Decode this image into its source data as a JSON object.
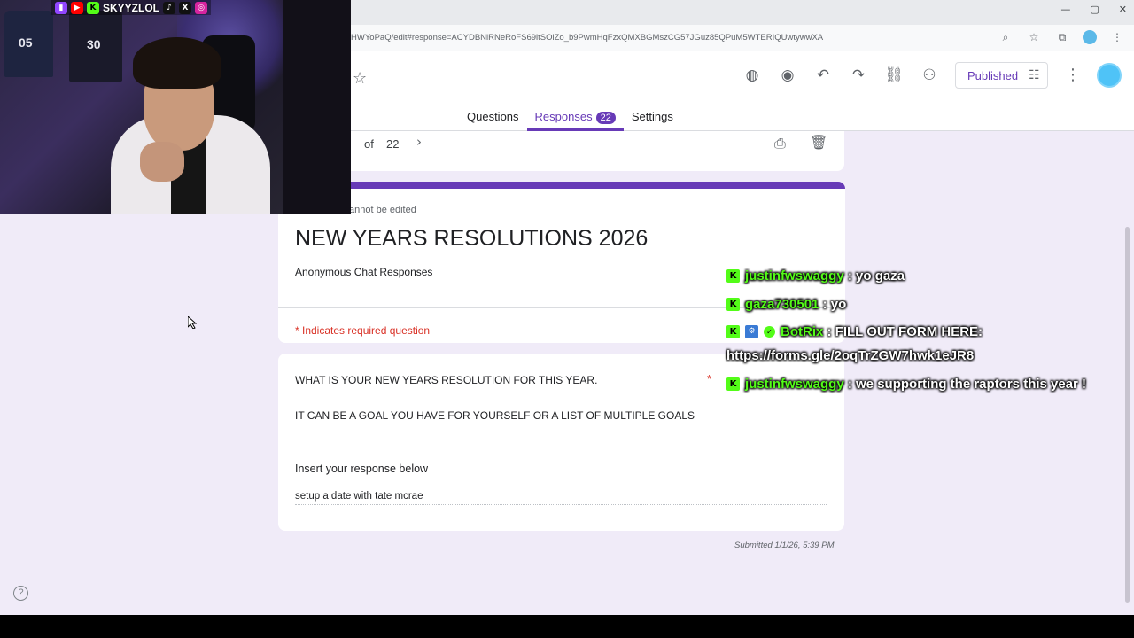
{
  "browser": {
    "url": "HWYoPaQ/edit#response=ACYDBNiRNeRoFS69ltSOlZo_b9PwmHqFzxQMXBGMszCG57JGuz85QPuM5WTERIQUwtywwXA",
    "window_controls": [
      "—",
      "▢",
      "✕"
    ],
    "icons": [
      "zoom-icon",
      "bookmark-star-icon",
      "extensions-icon",
      "profile-icon",
      "more-icon"
    ]
  },
  "toolbar": {
    "icons": [
      "palette-icon",
      "preview-eye-icon",
      "undo-icon",
      "redo-icon",
      "link-icon",
      "add-collaborator-icon"
    ],
    "published_label": "Published",
    "accent_color": "#673ab7"
  },
  "tabs": [
    {
      "label": "Questions",
      "active": false
    },
    {
      "label": "Responses",
      "active": true,
      "count": "22"
    },
    {
      "label": "Settings",
      "active": false
    }
  ],
  "response_nav": {
    "of_label": "of",
    "total": "22"
  },
  "form": {
    "edit_note": "annot be edited",
    "title": "NEW YEARS RESOLUTIONS 2026",
    "description": "Anonymous Chat Responses",
    "required_note": "* Indicates required question"
  },
  "question": {
    "line1": "WHAT IS YOUR NEW YEARS RESOLUTION FOR THIS YEAR.",
    "required_mark": "*",
    "line2": "IT CAN BE A GOAL YOU HAVE FOR YOURSELF OR A LIST OF MULTIPLE GOALS",
    "line3": "Insert your response below",
    "answer": "setup a date with tate mcrae"
  },
  "submitted": "Submitted 1/1/26, 5:39 PM",
  "help_label": "?",
  "stream": {
    "handle": "SKYYZLOL",
    "social_icons": [
      "twitch-icon",
      "youtube-icon",
      "kick-icon",
      "tiktok-icon",
      "x-icon",
      "instagram-icon"
    ],
    "jersey_numbers": [
      "05",
      "30"
    ]
  },
  "chat": [
    {
      "user": "justinfwswaggy",
      "message": " : yo gaza"
    },
    {
      "user": "gaza730501",
      "message": " : yo"
    },
    {
      "user": "BotRix",
      "message": " : FILL OUT FORM HERE:"
    },
    {
      "continuation": "https://forms.gle/2oqTrZGW7hwk1eJR8"
    },
    {
      "user": "justinfwswaggy",
      "message": " : we supporting the raptors this year !"
    }
  ]
}
